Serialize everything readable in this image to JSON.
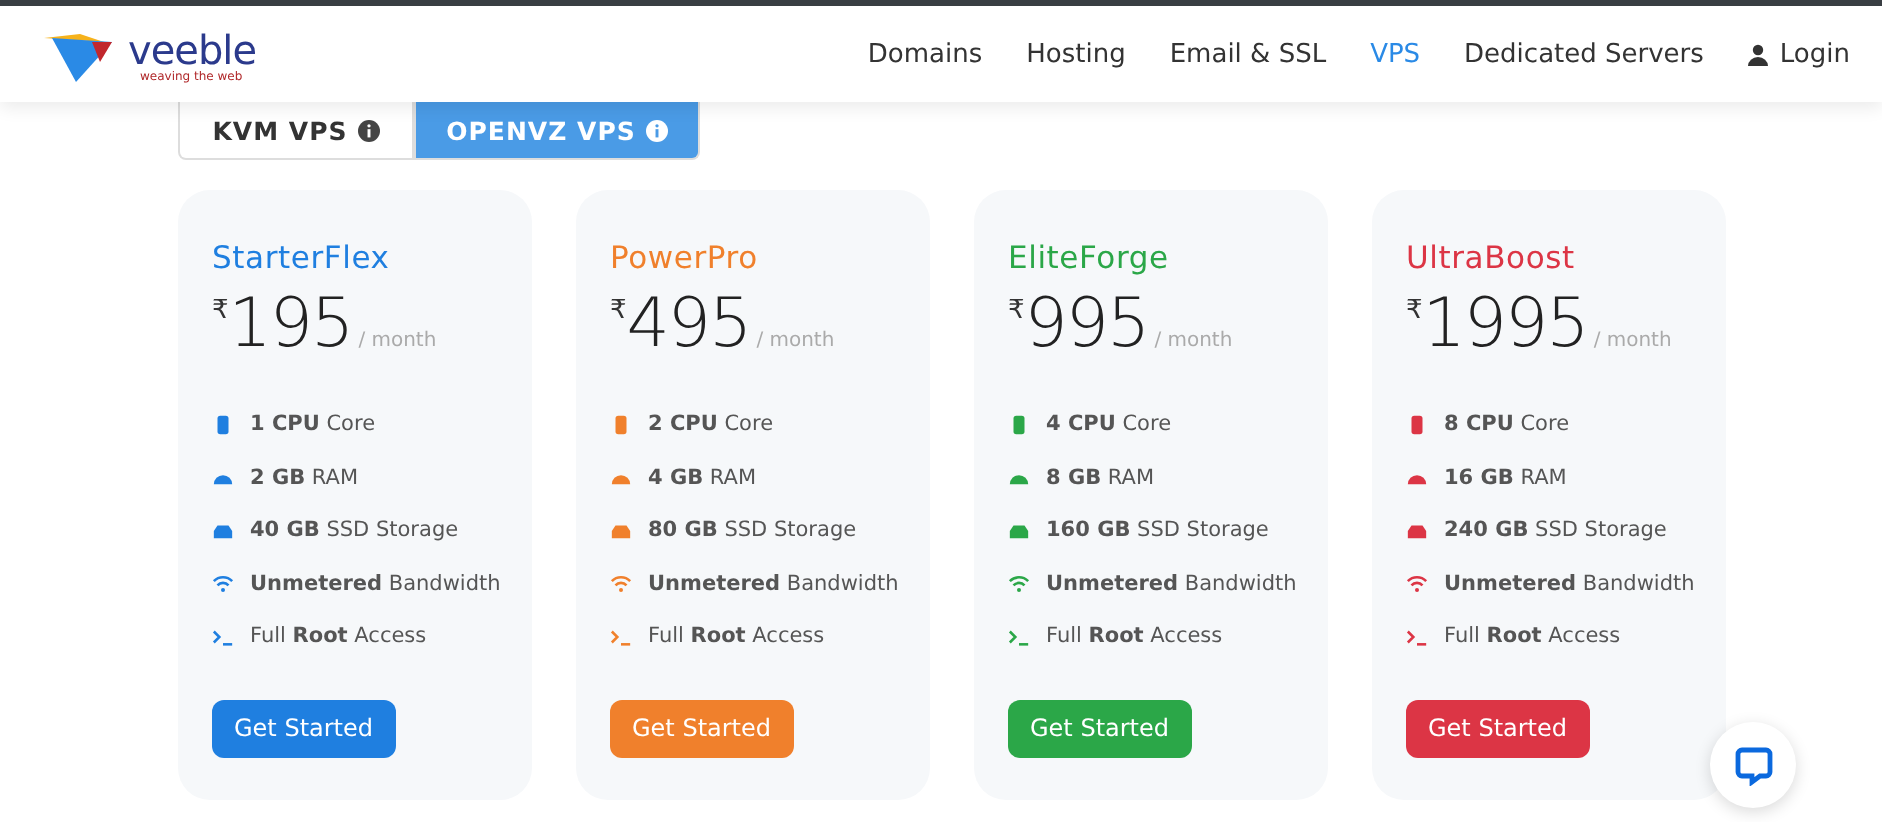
{
  "logo": {
    "name": "veeble",
    "tagline": "weaving the web"
  },
  "nav": [
    {
      "label": "Domains",
      "selected": false,
      "kind": "link"
    },
    {
      "label": "Hosting",
      "selected": false,
      "kind": "link"
    },
    {
      "label": "Email & SSL",
      "selected": false,
      "kind": "link"
    },
    {
      "label": "VPS",
      "selected": true,
      "kind": "link"
    },
    {
      "label": "Dedicated Servers",
      "selected": false,
      "kind": "link"
    },
    {
      "label": "Login",
      "selected": false,
      "kind": "login"
    }
  ],
  "tabs": [
    {
      "label": "KVM VPS",
      "selected": false
    },
    {
      "label": "OPENVZ VPS",
      "selected": true
    }
  ],
  "plans": [
    {
      "name": "StarterFlex",
      "color": "#1f7fe0",
      "currency": "₹",
      "price": "195",
      "period": "/ month",
      "button": "Get Started",
      "features": [
        {
          "kind": "cpu",
          "text": "**1 CPU** Core"
        },
        {
          "kind": "ram",
          "text": "**2 GB** RAM"
        },
        {
          "kind": "storage",
          "text": "**40 GB** SSD Storage"
        },
        {
          "kind": "bandwidth",
          "text": "**Unmetered** Bandwidth"
        },
        {
          "kind": "root",
          "text": "Full **Root** Access"
        }
      ]
    },
    {
      "name": "PowerPro",
      "color": "#f0802c",
      "currency": "₹",
      "price": "495",
      "period": "/ month",
      "button": "Get Started",
      "features": [
        {
          "kind": "cpu",
          "text": "**2 CPU** Core"
        },
        {
          "kind": "ram",
          "text": "**4 GB** RAM"
        },
        {
          "kind": "storage",
          "text": "**80 GB** SSD Storage"
        },
        {
          "kind": "bandwidth",
          "text": "**Unmetered** Bandwidth"
        },
        {
          "kind": "root",
          "text": "Full **Root** Access"
        }
      ]
    },
    {
      "name": "EliteForge",
      "color": "#2ba748",
      "currency": "₹",
      "price": "995",
      "period": "/ month",
      "button": "Get Started",
      "features": [
        {
          "kind": "cpu",
          "text": "**4 CPU** Core"
        },
        {
          "kind": "ram",
          "text": "**8 GB** RAM"
        },
        {
          "kind": "storage",
          "text": "**160 GB** SSD Storage"
        },
        {
          "kind": "bandwidth",
          "text": "**Unmetered** Bandwidth"
        },
        {
          "kind": "root",
          "text": "Full **Root** Access"
        }
      ]
    },
    {
      "name": "UltraBoost",
      "color": "#dc3545",
      "currency": "₹",
      "price": "1995",
      "period": "/ month",
      "button": "Get Started",
      "features": [
        {
          "kind": "cpu",
          "text": "**8 CPU** Core"
        },
        {
          "kind": "ram",
          "text": "**16 GB** RAM"
        },
        {
          "kind": "storage",
          "text": "**240 GB** SSD Storage"
        },
        {
          "kind": "bandwidth",
          "text": "**Unmetered** Bandwidth"
        },
        {
          "kind": "root",
          "text": "Full **Root** Access"
        }
      ]
    }
  ]
}
